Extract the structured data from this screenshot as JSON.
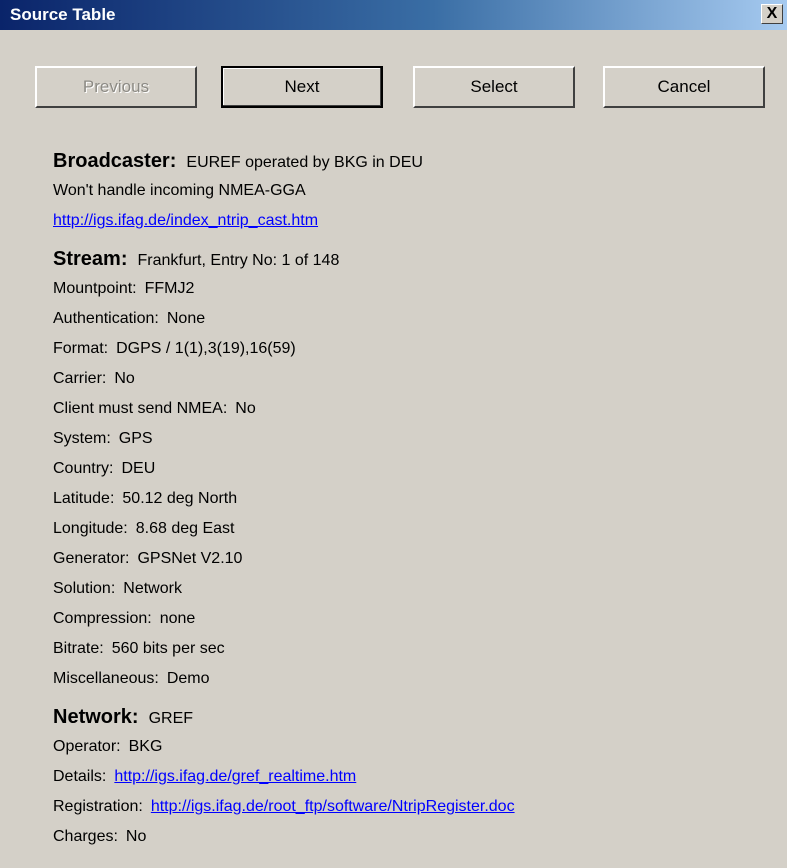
{
  "window": {
    "title": "Source Table",
    "close_symbol": "X"
  },
  "buttons": {
    "previous": "Previous",
    "next": "Next",
    "select": "Select",
    "cancel": "Cancel"
  },
  "broadcaster": {
    "heading": "Broadcaster:",
    "value": "EUREF operated by BKG in DEU",
    "nmea_note": "Won't handle incoming NMEA-GGA",
    "url": "http://igs.ifag.de/index_ntrip_cast.htm"
  },
  "stream": {
    "heading": "Stream:",
    "value": "Frankfurt, Entry No: 1 of 148",
    "fields": [
      {
        "label": "Mountpoint:",
        "value": "FFMJ2"
      },
      {
        "label": "Authentication:",
        "value": "None"
      },
      {
        "label": "Format:",
        "value": "DGPS / 1(1),3(19),16(59)"
      },
      {
        "label": "Carrier:",
        "value": "No"
      },
      {
        "label": "Client must send NMEA:",
        "value": "No"
      },
      {
        "label": "System:",
        "value": "GPS"
      },
      {
        "label": "Country:",
        "value": "DEU"
      },
      {
        "label": "Latitude:",
        "value": "50.12 deg North"
      },
      {
        "label": "Longitude:",
        "value": "8.68 deg East"
      },
      {
        "label": "Generator:",
        "value": "GPSNet V2.10"
      },
      {
        "label": "Solution:",
        "value": "Network"
      },
      {
        "label": "Compression:",
        "value": "none"
      },
      {
        "label": "Bitrate:",
        "value": "560 bits per sec"
      },
      {
        "label": "Miscellaneous:",
        "value": "Demo"
      }
    ]
  },
  "network": {
    "heading": "Network:",
    "value": "GREF",
    "operator_label": "Operator:",
    "operator_value": "BKG",
    "details_label": "Details:",
    "details_url": "http://igs.ifag.de/gref_realtime.htm",
    "registration_label": "Registration:",
    "registration_url": "http://igs.ifag.de/root_ftp/software/NtripRegister.doc",
    "charges_label": "Charges:",
    "charges_value": "No"
  }
}
